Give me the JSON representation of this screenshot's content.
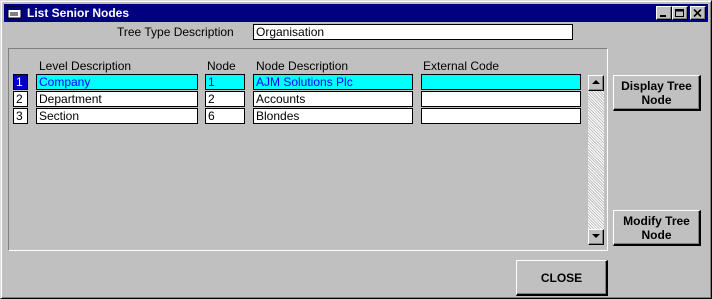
{
  "window": {
    "title": "List Senior Nodes"
  },
  "tree_type": {
    "label": "Tree Type Description",
    "value": "Organisation"
  },
  "grid": {
    "columns": [
      "Level Description",
      "Node",
      "Node Description",
      "External Code"
    ],
    "rows": [
      {
        "num": "1",
        "level": "Company",
        "node": "1",
        "description": "AJM Solutions Plc",
        "external": ""
      },
      {
        "num": "2",
        "level": "Department",
        "node": "2",
        "description": "Accounts",
        "external": ""
      },
      {
        "num": "3",
        "level": "Section",
        "node": "6",
        "description": "Blondes",
        "external": ""
      }
    ]
  },
  "buttons": {
    "display_tree_node": "Display Tree Node",
    "modify_tree_node": "Modify Tree Node",
    "close": "CLOSE"
  },
  "colors": {
    "title_bar": "#000080",
    "selected_row": "#00ffff",
    "selected_text": "#0000ff"
  }
}
